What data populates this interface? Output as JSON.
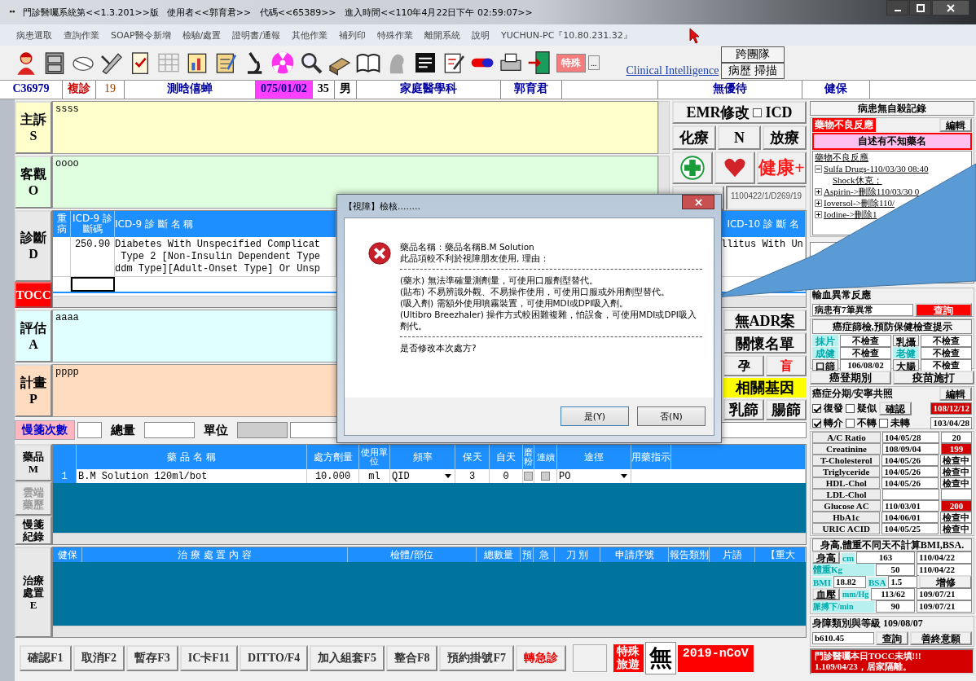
{
  "window": {
    "title": "門診醫囑系統第<<1.3.201>>版   使用者<<郭育君>>   代碼<<65389>>   進入時間<<110年4月22日下午 02:59:07>>"
  },
  "menu": [
    "病患選取",
    "查詢作業",
    "SOAP醫令新增",
    "檢驗/處置",
    "證明書/通報",
    "其他作業",
    "補列印",
    "特殊作業",
    "離開系統",
    "說明",
    "YUCHUN-PC『10.80.231.32』"
  ],
  "toolbar": {
    "special_button": "特殊",
    "more_button": "...",
    "link": "Clinical Intelligence",
    "buttons": [
      "跨團隊",
      "病歷 掃描"
    ]
  },
  "patient_bar": {
    "chart_no": "C36979",
    "visit_type": "複診",
    "visit_count": "19",
    "name": "測晗僖蝉",
    "birth_date": "075/01/02",
    "age": "35",
    "sex": "男",
    "department": "家庭醫學科",
    "doctor": "郭育君",
    "discount": "無優待",
    "insurance": "健保"
  },
  "notes": [
    {
      "label": "主訴",
      "letter": "S",
      "text": "ssss",
      "color": "#ffffcc"
    },
    {
      "label": "客觀",
      "letter": "O",
      "text": "oooo",
      "color": "#e0ffe0"
    },
    {
      "label": "評估",
      "letter": "A",
      "text": "aaaa",
      "color": "#e0ffff"
    },
    {
      "label": "計畫",
      "letter": "P",
      "text": "pppp",
      "color": "#ffdcc0"
    }
  ],
  "diagnosis": {
    "label": "診斷",
    "letter": "D",
    "tocc": "TOCC",
    "columns": [
      "重病",
      "ICD-9 診斷碼",
      "ICD-9 診 斷 名 稱",
      "ICD-10 診 斷 名"
    ],
    "rows": [
      {
        "icd9": "250.90",
        "name_lines": [
          "Diabetes With Unspecified Complicat",
          " Type 2 [Non-Insulin Dependent Type",
          "ddm Type][Adult-Onset Type] Or Unsp"
        ],
        "icd10_name": "llitus With Un"
      }
    ]
  },
  "emr_panel": {
    "emr_button": "EMR修改",
    "icd_checkbox": {
      "label": "ICD",
      "checked": false
    },
    "buttons": [
      "化療",
      "N",
      "放療"
    ],
    "health_button": "健康+",
    "sdm_code": "1100422/1/D269/19"
  },
  "care_panel": {
    "adr_button": "無ADR案",
    "care_list_button": "關懷名單",
    "small_buttons": [
      "孕",
      "盲"
    ],
    "gene_button": "相關基因",
    "screen_buttons": [
      "乳篩",
      "腸篩"
    ]
  },
  "chronic": {
    "label": "慢箋次數",
    "total_label": "總量",
    "unit_label": "單位"
  },
  "drug_tabs": [
    {
      "label": "藥品",
      "letter": "M",
      "disabled": false
    },
    {
      "label": "雲端藥歷",
      "disabled": true
    },
    {
      "label": "慢箋紀錄",
      "disabled": false
    }
  ],
  "drug_table": {
    "columns": [
      "藥 品 名 稱",
      "處方劑量",
      "使用單位",
      "頻率",
      "保天",
      "自天",
      "磨粉",
      "連續",
      "途徑",
      "用藥指示"
    ],
    "rows": [
      {
        "no": "1",
        "name": "B.M Solution 120ml/bot",
        "dose": "10.000",
        "unit": "ml",
        "frequency": "QID",
        "days": "3",
        "self_days": "0",
        "grind": false,
        "continuous": false,
        "route": "PO"
      }
    ]
  },
  "treatment": {
    "label": "治療處置",
    "letter": "E",
    "columns": [
      "健保",
      "治 療 處 置 內 容",
      "檢體/部位",
      "總數量",
      "預",
      "急",
      "刀 別",
      "申請序號",
      "報告類別",
      "片語",
      "【重大"
    ]
  },
  "bottom_buttons": [
    {
      "label": "確認F1",
      "kind": "normal"
    },
    {
      "label": "取消F2",
      "kind": "normal"
    },
    {
      "label": "暫存F3",
      "kind": "normal"
    },
    {
      "label": "IC卡F11",
      "kind": "normal"
    },
    {
      "label": "DITTO/F4",
      "kind": "normal"
    },
    {
      "label": "加入組套F5",
      "kind": "normal"
    },
    {
      "label": "整合F8",
      "kind": "normal"
    },
    {
      "label": "預約掛號F7",
      "kind": "normal"
    },
    {
      "label": "轉急診",
      "kind": "urgent"
    }
  ],
  "badges": {
    "travel": "特殊旅遊",
    "none": "無",
    "ncov": "2019-nCoV"
  },
  "right_panel": {
    "suicide_record": "病患無自殺記錄",
    "adr": {
      "title": "藥物不良反應",
      "edit_button": "編輯",
      "note": "自述有不知藥名",
      "tree": {
        "label": "藥物不良反應",
        "children": [
          {
            "label": "Sulfa Drugs-110/03/30 08:40",
            "expanded": true,
            "children": [
              {
                "label": "Shock休克；"
              }
            ]
          },
          {
            "label": "Aspirin->刪除110/03/30 0",
            "expanded": false
          },
          {
            "label": "Ioversol->刪除110/",
            "expanded": false
          },
          {
            "label": "Iodine->刪除1",
            "expanded": false
          }
        ]
      }
    },
    "transfusion": {
      "title": "輸血異常反應",
      "status": "病患有7筆異常",
      "query_button": "查詢"
    },
    "screening": {
      "title": "癌症篩檢,預防保健檢查提示",
      "items": [
        {
          "label": "抹片",
          "value": "不檢查",
          "kind": "tag"
        },
        {
          "label": "乳攝",
          "value": "不檢查",
          "kind": "button"
        },
        {
          "label": "成健",
          "value": "不檢查",
          "kind": "tag"
        },
        {
          "label": "老健",
          "value": "不檢查",
          "kind": "tag"
        },
        {
          "label": "口篩",
          "value": "106/08/02",
          "kind": "button"
        },
        {
          "label": "大腸",
          "value": "不檢查",
          "kind": "button"
        }
      ]
    },
    "cancer_buttons": [
      "癌登期別",
      "疫苗施打"
    ],
    "staging": {
      "title": "癌症分期/安寧共照",
      "edit_button": "編輯",
      "row1": {
        "checkboxes": [
          {
            "label": "復發",
            "checked": true
          },
          {
            "label": "疑似",
            "checked": false
          }
        ],
        "confirm_button": "確認",
        "date": "108/12/12",
        "alert": true
      },
      "row2": {
        "checkboxes": [
          {
            "label": "轉介",
            "checked": true
          },
          {
            "label": "不轉",
            "checked": false
          },
          {
            "label": "未轉",
            "checked": false
          }
        ],
        "date": "103/04/28",
        "alert": false
      }
    },
    "labs": [
      {
        "name": "A/C Ratio",
        "date": "104/05/28",
        "value": "20",
        "alert": false
      },
      {
        "name": "Creatinine",
        "date": "108/09/04",
        "value": "199",
        "alert": true
      },
      {
        "name": "T-Cholesterol",
        "date": "104/05/26",
        "value": "檢查中",
        "alert": false
      },
      {
        "name": "Triglyceride",
        "date": "104/05/26",
        "value": "檢查中",
        "alert": false
      },
      {
        "name": "HDL-Chol",
        "date": "104/05/26",
        "value": "檢查中",
        "alert": false
      },
      {
        "name": "LDL-Chol",
        "alert": false
      },
      {
        "name": "Glucose AC",
        "date": "110/03/01",
        "value": "200",
        "alert": true
      },
      {
        "name": "HbA1c",
        "date": "104/06/01",
        "value": "檢查中",
        "alert": false
      },
      {
        "name": "URIC ACID",
        "date": "104/05/25",
        "value": "檢查中",
        "alert": false
      }
    ],
    "vitals": {
      "note": "身高,體重不同天不計算BMI,BSA.",
      "height": {
        "button": "身高",
        "unit": "cm",
        "value": "163",
        "date": "110/04/22"
      },
      "weight": {
        "label": "體重Kg",
        "value": "50",
        "date": "110/04/22"
      },
      "bmi": {
        "label": "BMI",
        "value": "18.82"
      },
      "bsa": {
        "label": "BSA",
        "value": "1.5"
      },
      "edit_button": "增修",
      "bp": {
        "button": "血壓",
        "unit": "mm/Hg",
        "value": "113/62",
        "date": "109/07/21"
      },
      "pulse": {
        "label": "脈搏下/min",
        "value": "90",
        "date": "109/07/21"
      }
    },
    "disability": {
      "title": "身障類別與等級 109/08/07",
      "code": "b610.45",
      "query_button": "查詢",
      "hospice_button": "善終意願"
    },
    "alert_lines": [
      "門診醫囑本日TOCC未填!!!",
      "1.109/04/23，居家隔離。"
    ]
  },
  "dialog": {
    "title": "【視障】檢核........",
    "intro": [
      "藥品名稱：藥品名稱B.M Solution",
      "此品項較不利於視障朋友使用, 理由："
    ],
    "reasons": [
      "(藥水) 無法準確量測劑量，可使用口服劑型替代。",
      "(貼布) 不易辨識外觀、不易操作使用，可使用口服或外用劑型替代。",
      "(吸入劑) 需額外使用噴霧裝置，可使用MDI或DPI吸入劑。",
      "(Ultibro Breezhaler) 操作方式較困難複雜，怕誤食，可使用MDI或DPI吸入劑代。"
    ],
    "question": "是否修改本次處方?",
    "buttons": [
      "是(Y)",
      "否(N)"
    ]
  }
}
